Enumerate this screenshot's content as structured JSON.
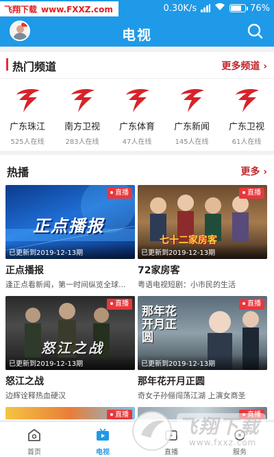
{
  "statusbar": {
    "watermark_name": "飞翔下载",
    "watermark_url": "www.FXXZ.com",
    "speed": "0.30K/s",
    "battery": "76%",
    "battery_level": 0.76
  },
  "appbar": {
    "title": "电视"
  },
  "hot_channels": {
    "title": "热门频道",
    "more": "更多频道",
    "items": [
      {
        "name": "广东珠江",
        "online": "525人在线"
      },
      {
        "name": "南方卫视",
        "online": "283人在线"
      },
      {
        "name": "广东体育",
        "online": "47人在线"
      },
      {
        "name": "广东新闻",
        "online": "145人在线"
      },
      {
        "name": "广东卫视",
        "online": "61人在线"
      }
    ]
  },
  "hot_shows": {
    "title": "热播",
    "more": "更多",
    "live_label": "直播",
    "items": [
      {
        "title": "正点播报",
        "desc": "逢正点看新闻，第一时间纵览全球...",
        "updated": "已更新到2019-12-13期",
        "thumb_text": "正点播报"
      },
      {
        "title": "72家房客",
        "desc": "粤语电视短剧：小市民的生活",
        "updated": "已更新到2019-12-13期",
        "thumb_text": "七十二家房客"
      },
      {
        "title": "怒江之战",
        "desc": "边辉诠释热血硬汉",
        "updated": "已更新到2019-12-13期",
        "thumb_text": "怒江之战"
      },
      {
        "title": "那年花开月正圆",
        "desc": "奇女子孙俪闯荡江湖 上演女商圣",
        "updated": "已更新到2019-12-13期",
        "thumb_text": "那年花开月正圆"
      }
    ]
  },
  "bottom_nav": {
    "items": [
      {
        "label": "首页",
        "icon": "home-icon"
      },
      {
        "label": "电视",
        "icon": "tv-icon"
      },
      {
        "label": "直播",
        "icon": "live-icon"
      },
      {
        "label": "服务",
        "icon": "service-icon"
      }
    ],
    "active": "电视"
  },
  "watermark_bottom": {
    "name": "飞翔下载",
    "url": "www.fxxz.com"
  },
  "colors": {
    "primary": "#1e9ae8",
    "accent": "#e03030",
    "live": "#e8383d"
  }
}
